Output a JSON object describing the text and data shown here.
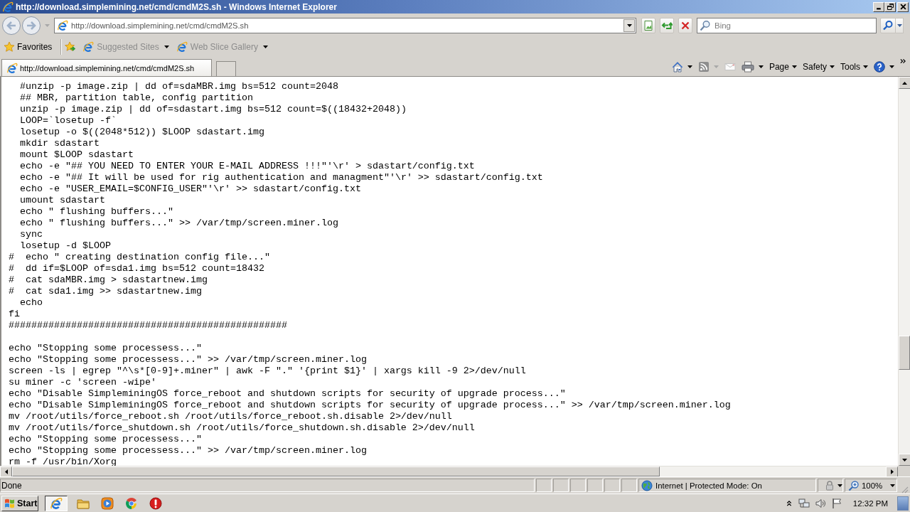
{
  "window": {
    "title": "http://download.simplemining.net/cmd/cmdM2S.sh - Windows Internet Explorer"
  },
  "navigation": {
    "buttons": [
      {
        "kind": "back",
        "disabled": true
      },
      {
        "kind": "forward",
        "disabled": true
      }
    ],
    "address": "http://download.simplemining.net/cmd/cmdM2S.sh",
    "search": {
      "placeholder": "Bing"
    }
  },
  "favorites_bar": {
    "label": "Favorites",
    "links": [
      {
        "label": "Suggested Sites",
        "disabled": true
      },
      {
        "label": "Web Slice Gallery",
        "disabled": true
      }
    ]
  },
  "tabs": [
    {
      "label": "http://download.simplemining.net/cmd/cmdM2S.sh",
      "selected": true
    }
  ],
  "command_bar": {
    "buttons": [
      {
        "kind": "home",
        "disabled": false
      },
      {
        "kind": "feeds",
        "disabled": true
      },
      {
        "kind": "mail",
        "disabled": true
      },
      {
        "kind": "print",
        "disabled": false
      }
    ],
    "menus": [
      {
        "label": "Page"
      },
      {
        "label": "Safety"
      },
      {
        "label": "Tools"
      }
    ]
  },
  "content": {
    "blocks": [
      {
        "lines": [
          "  #unzip -p image.zip | dd of=sdaMBR.img bs=512 count=2048",
          "  ## MBR, partition table, config partition",
          "  unzip -p image.zip | dd of=sdastart.img bs=512 count=$((18432+2048))",
          "  LOOP=`losetup -f`",
          "  losetup -o $((2048*512)) $LOOP sdastart.img",
          "  mkdir sdastart",
          "  mount $LOOP sdastart",
          "  echo -e \"## YOU NEED TO ENTER YOUR E-MAIL ADDRESS !!!\"'\\r' > sdastart/config.txt",
          "  echo -e \"## It will be used for rig authentication and managment\"'\\r' >> sdastart/config.txt",
          "  echo -e \"USER_EMAIL=$CONFIG_USER\"'\\r' >> sdastart/config.txt",
          "  umount sdastart",
          "  echo \" flushing buffers...\"",
          "  echo \" flushing buffers...\" >> /var/tmp/screen.miner.log",
          "  sync",
          "  losetup -d $LOOP",
          "#  echo \" creating destination config file...\"",
          "#  dd if=$LOOP of=sda1.img bs=512 count=18432",
          "#  cat sdaMBR.img > sdastartnew.img",
          "#  cat sda1.img >> sdastartnew.img",
          "  echo",
          "fi",
          "#################################################"
        ]
      },
      {
        "lines": [
          "echo \"Stopping some processess...\"",
          "echo \"Stopping some processess...\" >> /var/tmp/screen.miner.log",
          "screen -ls | egrep \"^\\s*[0-9]+.miner\" | awk -F \".\" '{print $1}' | xargs kill -9 2>/dev/null",
          "su miner -c 'screen -wipe'",
          "echo \"Disable SimpleminingOS force_reboot and shutdown scripts for security of upgrade process...\"",
          "echo \"Disable SimpleminingOS force_reboot and shutdown scripts for security of upgrade process...\" >> /var/tmp/screen.miner.log",
          "mv /root/utils/force_reboot.sh /root/utils/force_reboot.sh.disable 2>/dev/null",
          "mv /root/utils/force_shutdown.sh /root/utils/force_shutdown.sh.disable 2>/dev/null",
          "echo \"Stopping some processess...\"",
          "echo \"Stopping some processess...\" >> /var/tmp/screen.miner.log",
          "rm -f /usr/bin/Xorg"
        ]
      }
    ]
  },
  "status_bar": {
    "text": "Done",
    "zone": "Internet | Protected Mode: On",
    "zoom": "100%"
  },
  "taskbar": {
    "start": "Start",
    "apps": [
      {
        "kind": "ie",
        "selected": true
      },
      {
        "kind": "folder",
        "selected": false
      },
      {
        "kind": "player",
        "selected": false
      },
      {
        "kind": "chrome",
        "selected": false
      },
      {
        "kind": "alert",
        "selected": false
      }
    ],
    "clock": "12:32 PM"
  }
}
